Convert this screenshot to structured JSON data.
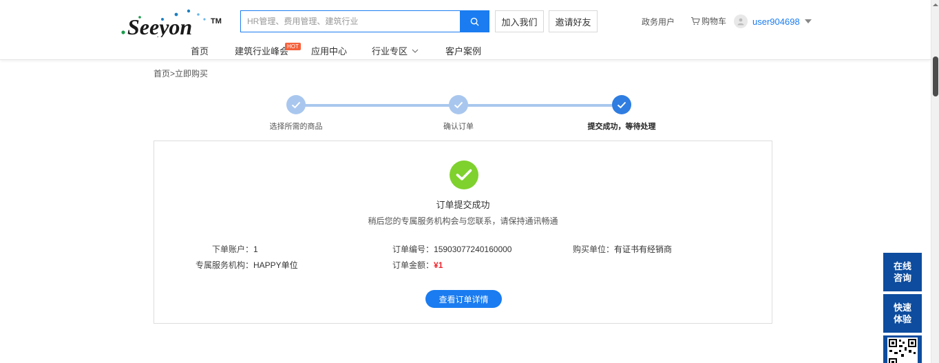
{
  "header": {
    "logo_text": "Seeyon",
    "logo_tm": "TM",
    "search_placeholder": "HR管理、费用管理、建筑行业",
    "join_label": "加入我们",
    "invite_label": "邀请好友",
    "gov_label": "政务用户",
    "cart_label": "购物车",
    "username": "user904698"
  },
  "nav": {
    "items": [
      "首页",
      "建筑行业峰会",
      "应用中心",
      "行业专区",
      "客户案例"
    ],
    "hot_badge": "HOT"
  },
  "breadcrumb": "首页>立即购买",
  "steps": [
    {
      "label": "选择所需的商品",
      "active": false
    },
    {
      "label": "确认订单",
      "active": false
    },
    {
      "label": "提交成功，等待处理",
      "active": true
    }
  ],
  "result": {
    "title": "订单提交成功",
    "subtitle": "稍后您的专属服务机构会与您联系，请保持通讯畅通",
    "account_label": "下单账户：",
    "account_value": "1",
    "order_no_label": "订单编号：",
    "order_no_value": "15903077240160000",
    "buyer_label": "购买单位：",
    "buyer_value": "有证书有经销商",
    "agency_label": "专属服务机构：",
    "agency_value": "HAPPY单位",
    "amount_label": "订单金额：",
    "amount_value": "¥1",
    "detail_button": "查看订单详情"
  },
  "float": {
    "consult_1": "在线",
    "consult_2": "咨询",
    "trial_1": "快速",
    "trial_2": "体验"
  },
  "colors": {
    "primary": "#1a7cf0",
    "step_done": "#a9c7ee",
    "step_active": "#2f7de1",
    "success": "#7fd12d",
    "price": "#f0232c",
    "float_bg": "#0d4c9e"
  }
}
